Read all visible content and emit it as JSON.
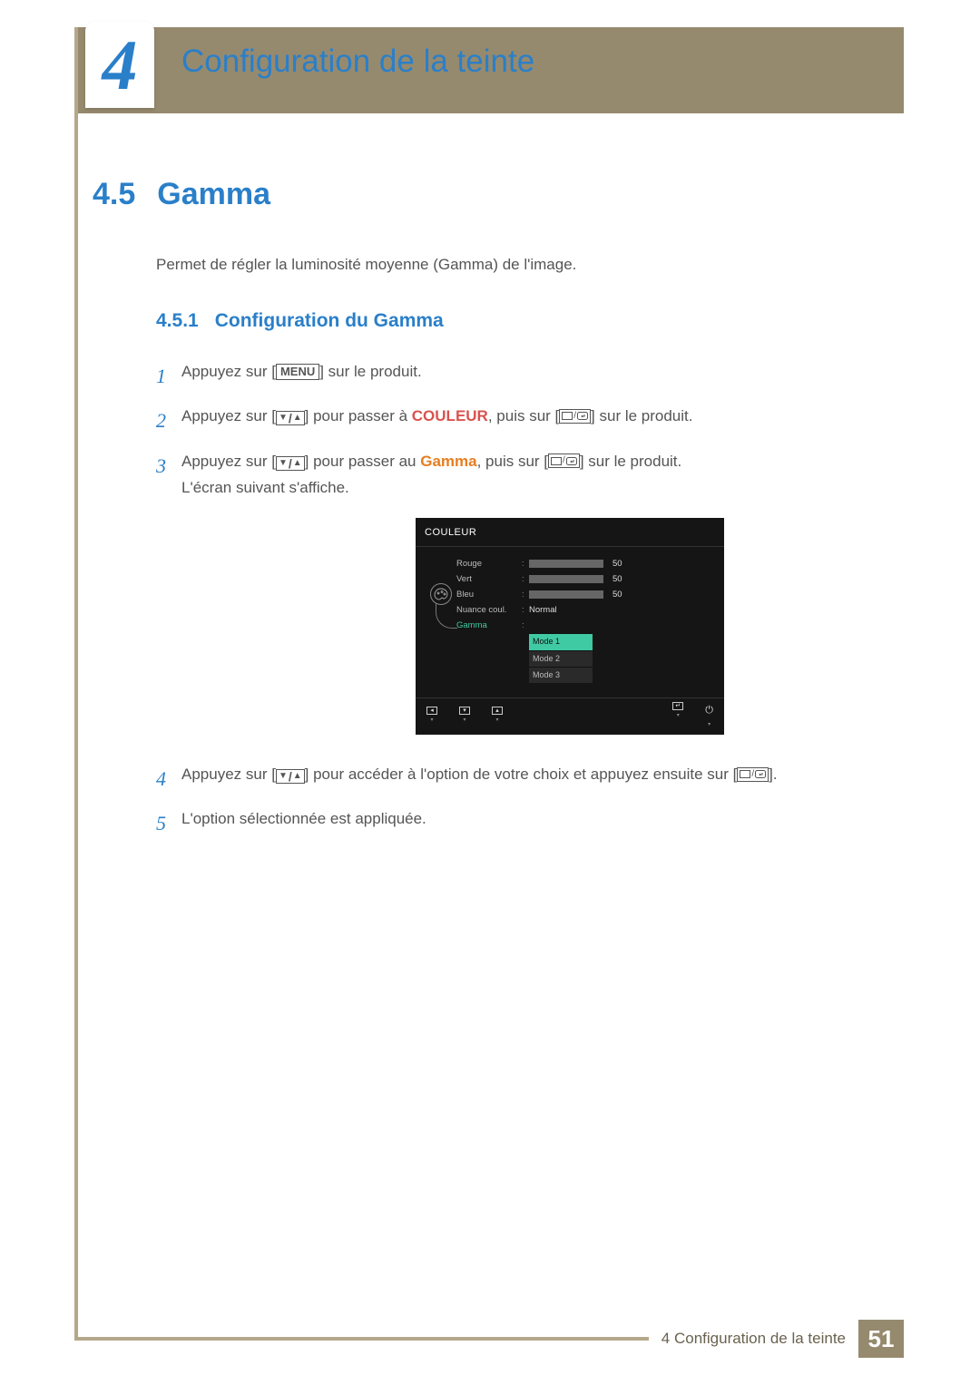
{
  "chapter": {
    "number": "4",
    "title": "Configuration de la teinte"
  },
  "section": {
    "number": "4.5",
    "title": "Gamma",
    "intro": "Permet de régler la luminosité moyenne (Gamma) de l'image."
  },
  "subsection": {
    "number": "4.5.1",
    "title": "Configuration du Gamma"
  },
  "buttons": {
    "menu": "MENU"
  },
  "steps": {
    "s1": {
      "n": "1",
      "pre": "Appuyez sur [",
      "post": "] sur le produit."
    },
    "s2": {
      "n": "2",
      "pre": "Appuyez sur [",
      "mid1": "] pour passer à ",
      "target": "COULEUR",
      "mid2": ", puis sur [",
      "post": "] sur le produit."
    },
    "s3": {
      "n": "3",
      "pre": "Appuyez sur [",
      "mid1": "] pour passer au ",
      "target": "Gamma",
      "mid2": ", puis sur [",
      "post": "] sur le produit.",
      "line2": "L'écran suivant s'affiche."
    },
    "s4": {
      "n": "4",
      "pre": "Appuyez sur [",
      "mid": "] pour accéder à l'option de votre choix et appuyez ensuite sur [",
      "post": "]."
    },
    "s5": {
      "n": "5",
      "text": "L'option sélectionnée est appliquée."
    }
  },
  "osd": {
    "title": "COULEUR",
    "rows": {
      "rouge": {
        "label": "Rouge",
        "value": "50"
      },
      "vert": {
        "label": "Vert",
        "value": "50"
      },
      "bleu": {
        "label": "Bleu",
        "value": "50"
      },
      "nuance": {
        "label": "Nuance coul.",
        "value": "Normal"
      },
      "gamma": {
        "label": "Gamma"
      }
    },
    "dropdown": {
      "opt1": "Mode 1",
      "opt2": "Mode 2",
      "opt3": "Mode 3"
    }
  },
  "footer": {
    "text": "4 Configuration de la teinte",
    "page": "51"
  }
}
